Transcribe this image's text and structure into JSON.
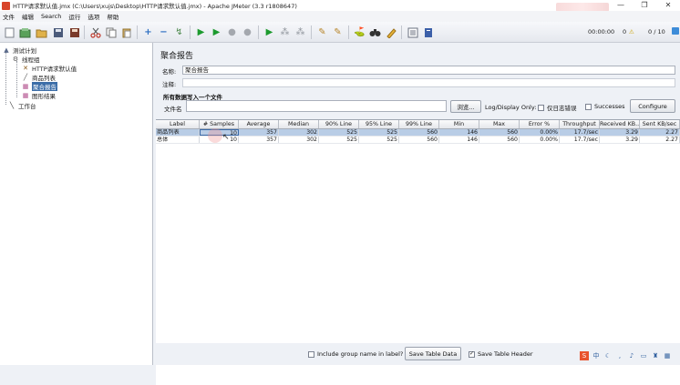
{
  "window": {
    "title": "HTTP请求默认值.jmx (C:\\Users\\xujs\\Desktop\\HTTP请求默认值.jmx) - Apache JMeter (3.3 r1808647)",
    "controls": [
      "—",
      "❐",
      "✕"
    ]
  },
  "menu": [
    "文件",
    "编辑",
    "Search",
    "运行",
    "选项",
    "帮助"
  ],
  "toolbar": {
    "icons": [
      "new-icon",
      "templates-icon",
      "open-icon",
      "save-icon",
      "save-as-icon",
      "cut-icon",
      "copy-icon",
      "paste-icon",
      "expand-icon",
      "collapse-icon",
      "toggle-icon",
      "start-icon",
      "start-no-pause-icon",
      "stop-icon",
      "shutdown-icon",
      "remote-start-icon",
      "remote-stop-icon",
      "remote-exit-icon",
      "clear-icon",
      "clear-all-icon",
      "search-icon",
      "reset-search-icon",
      "function-helper-icon",
      "help-icon"
    ],
    "elapsed_time": "00:00:00",
    "warnings": "0",
    "threads": "0 / 10"
  },
  "tree": {
    "test_plan": "测试计划",
    "thread_group": "线程组",
    "http_defaults": "HTTP请求默认值",
    "product_list": "商品列表",
    "aggregate_report": "聚合报告",
    "graph_results": "图形结果",
    "workbench": "工作台"
  },
  "panel": {
    "title": "聚合报告",
    "name_label": "名称:",
    "name_value": "聚合报告",
    "comment_label": "注释:",
    "comment_value": "",
    "group_title": "所有数据写入一个文件",
    "filename_label": "文件名",
    "filename_value": "",
    "browse_button": "浏览...",
    "log_display_label": "Log/Display Only:",
    "errors_only_label": "仅日志错误",
    "successes_label": "Successes",
    "configure_button": "Configure"
  },
  "table": {
    "columns": [
      "Label",
      "# Samples",
      "Average",
      "Median",
      "90% Line",
      "95% Line",
      "99% Line",
      "Min",
      "Max",
      "Error %",
      "Throughput",
      "Received KB...",
      "Sent KB/sec"
    ],
    "rows": [
      [
        "商品列表",
        "10",
        "357",
        "302",
        "525",
        "525",
        "560",
        "146",
        "560",
        "0.00%",
        "17.7/sec",
        "3.29",
        "2.27"
      ],
      [
        "总体",
        "10",
        "357",
        "302",
        "525",
        "525",
        "560",
        "146",
        "560",
        "0.00%",
        "17.7/sec",
        "3.29",
        "2.27"
      ]
    ]
  },
  "bottom": {
    "include_group_label": "Include group name in label?",
    "save_table_data_button": "Save Table Data",
    "save_table_header_label": "Save Table Header"
  }
}
